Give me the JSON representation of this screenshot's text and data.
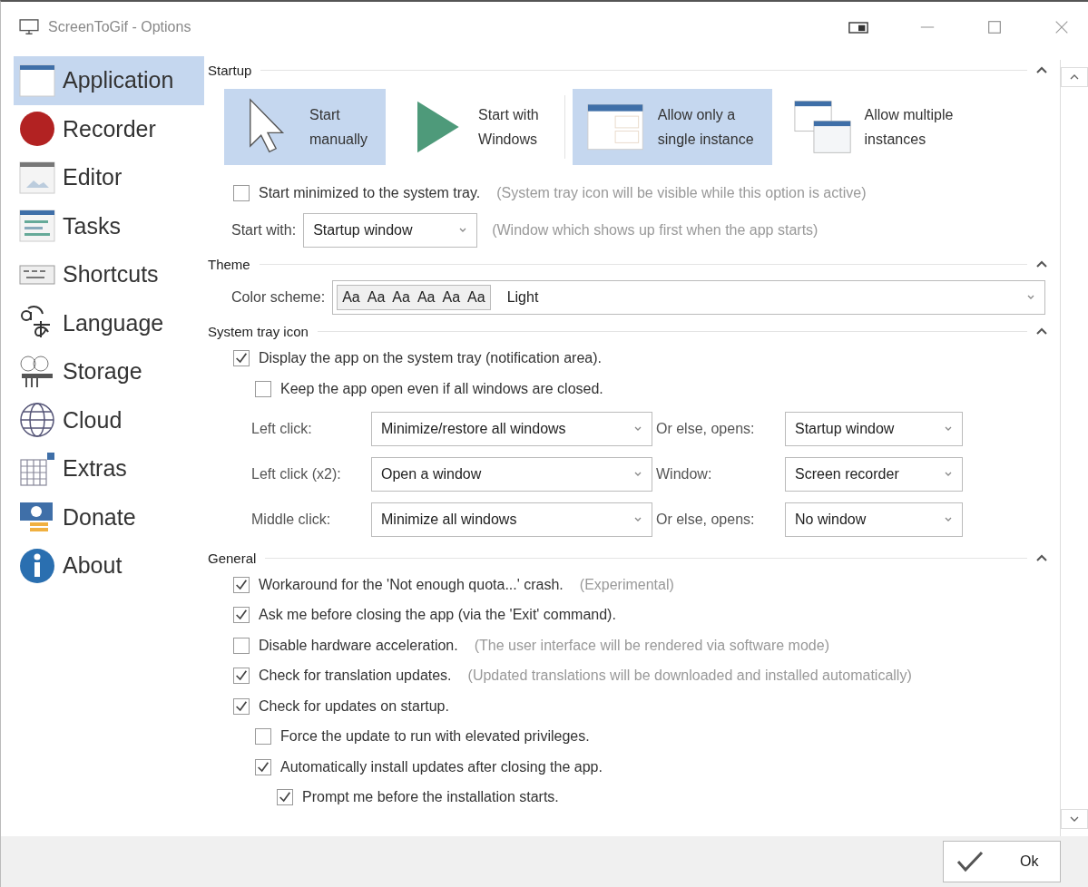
{
  "window": {
    "title": "ScreenToGif - Options"
  },
  "sidebar": {
    "items": [
      {
        "label": "Application",
        "selected": true
      },
      {
        "label": "Recorder",
        "selected": false
      },
      {
        "label": "Editor",
        "selected": false
      },
      {
        "label": "Tasks",
        "selected": false
      },
      {
        "label": "Shortcuts",
        "selected": false
      },
      {
        "label": "Language",
        "selected": false
      },
      {
        "label": "Storage",
        "selected": false
      },
      {
        "label": "Cloud",
        "selected": false
      },
      {
        "label": "Extras",
        "selected": false
      },
      {
        "label": "Donate",
        "selected": false
      },
      {
        "label": "About",
        "selected": false
      }
    ]
  },
  "startup": {
    "title": "Startup",
    "modes": [
      {
        "lines": [
          "Start",
          "manually"
        ],
        "selected": true
      },
      {
        "lines": [
          "Start with",
          "Windows"
        ],
        "selected": false
      },
      {
        "lines": [
          "Allow only a",
          "single instance"
        ],
        "selected": true
      },
      {
        "lines": [
          "Allow multiple",
          "instances"
        ],
        "selected": false
      }
    ],
    "options": [
      {
        "label": "Start minimized to the system tray.",
        "hint": "(System tray icon will be visible while this option is active)",
        "checked": false
      }
    ],
    "start_with": {
      "label": "Start with:",
      "value": "Startup window",
      "hint": "(Window which shows up first when the app starts)"
    }
  },
  "theme": {
    "title": "Theme",
    "label": "Color scheme:",
    "samples": [
      "Aa",
      "Aa",
      "Aa",
      "Aa",
      "Aa",
      "Aa"
    ],
    "value": "Light"
  },
  "tray": {
    "title": "System tray icon",
    "options": [
      {
        "label": "Display the app on the system tray (notification area).",
        "checked": true,
        "children": [
          {
            "label": "Keep the app open even if all windows are closed.",
            "checked": false
          }
        ]
      }
    ],
    "actions": [
      {
        "label": "Left click:",
        "value": "Minimize/restore all windows",
        "label2": "Or else, opens:",
        "value2": "Startup window"
      },
      {
        "label": "Left click (x2):",
        "value": "Open a window",
        "label2": "Window:",
        "value2": "Screen recorder"
      },
      {
        "label": "Middle click:",
        "value": "Minimize all windows",
        "label2": "Or else, opens:",
        "value2": "No window"
      }
    ]
  },
  "general": {
    "title": "General",
    "options": [
      {
        "label": "Workaround for the 'Not enough quota...' crash.",
        "hint": "(Experimental)",
        "checked": true
      },
      {
        "label": "Ask me before closing the app (via the 'Exit' command).",
        "checked": true
      },
      {
        "label": "Disable hardware acceleration.",
        "hint": "(The user interface will be rendered via software mode)",
        "checked": false
      },
      {
        "label": "Check for translation updates.",
        "hint": "(Updated translations will be downloaded and installed automatically)",
        "checked": true
      },
      {
        "label": "Check for updates on startup.",
        "checked": true,
        "children": [
          {
            "label": "Force the update to run with elevated privileges.",
            "checked": false
          },
          {
            "label": "Automatically install updates after closing the app.",
            "checked": true,
            "children": [
              {
                "label": "Prompt me before the installation starts.",
                "checked": true
              }
            ]
          }
        ]
      }
    ]
  },
  "footer": {
    "ok": "Ok"
  }
}
